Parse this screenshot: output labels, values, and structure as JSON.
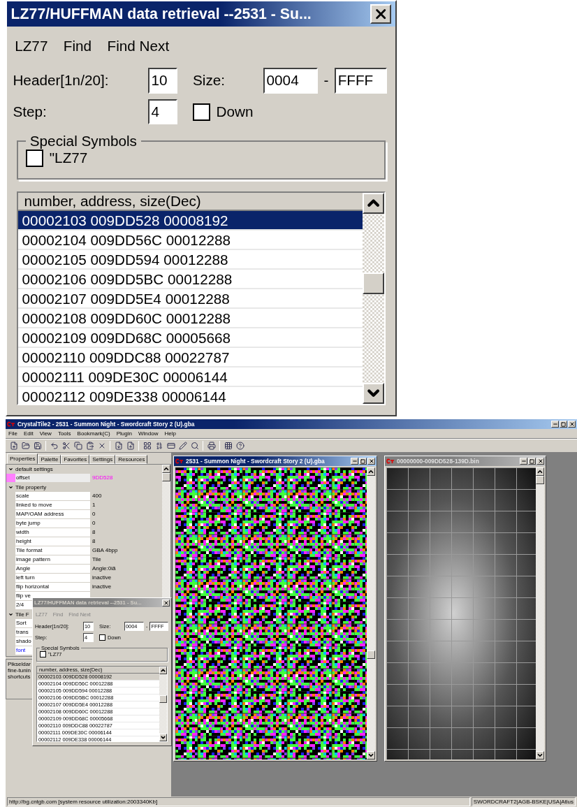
{
  "zoomed_dialog": {
    "title": "LZ77/HUFFMAN data retrieval --2531 - Su...",
    "active": true,
    "menu": [
      "LZ77",
      "Find",
      "Find Next"
    ],
    "header_label": "Header[1n/20]:",
    "header_value": "10",
    "size_label": "Size:",
    "size_from": "0004",
    "size_separator": "-",
    "size_to": "FFFF",
    "step_label": "Step:",
    "step_value": "4",
    "down": {
      "label": "Down",
      "checked": false
    },
    "group_title": "Special Symbols",
    "lz77": {
      "label": "\"LZ77",
      "checked": false
    },
    "list_header": "number, address, size(Dec)",
    "rows": [
      {
        "text": "00002103 009DD528 00008192",
        "selected": true
      },
      {
        "text": "00002104 009DD56C 00012288",
        "selected": false
      },
      {
        "text": "00002105 009DD594 00012288",
        "selected": false
      },
      {
        "text": "00002106 009DD5BC 00012288",
        "selected": false
      },
      {
        "text": "00002107 009DD5E4 00012288",
        "selected": false
      },
      {
        "text": "00002108 009DD60C 00012288",
        "selected": false
      },
      {
        "text": "00002109 009DD68C 00005668",
        "selected": false
      },
      {
        "text": "00002110 009DDC88 00022787",
        "selected": false
      },
      {
        "text": "00002111 009DE30C 00006144",
        "selected": false
      },
      {
        "text": "00002112 009DE338 00006144",
        "selected": false
      }
    ]
  },
  "app": {
    "title": "CrystalTile2 - 2531 - Summon Night - Swordcraft Story 2 (U).gba",
    "menu": [
      "File",
      "Edit",
      "View",
      "Tools",
      "Bookmark(C)",
      "Plugin",
      "Window",
      "Help"
    ],
    "panel_tabs": [
      {
        "label": "Properties",
        "selected": true
      },
      {
        "label": "Palette",
        "selected": false
      },
      {
        "label": "Favorites",
        "selected": false
      },
      {
        "label": "Settings",
        "selected": false
      },
      {
        "label": "Resources",
        "selected": false
      }
    ],
    "property_grid": [
      {
        "kind": "category",
        "label": "default settings",
        "expanded": true,
        "selected": false
      },
      {
        "kind": "property",
        "label": "offset",
        "value": "9DD528",
        "selected": true
      },
      {
        "kind": "category",
        "label": "Tile property",
        "expanded": true,
        "selected": false
      },
      {
        "kind": "property",
        "label": "scale",
        "value": "400",
        "selected": false
      },
      {
        "kind": "property",
        "label": "linked to move",
        "value": "1",
        "selected": false
      },
      {
        "kind": "property",
        "label": "MAP/OAM address",
        "value": "0",
        "selected": false
      },
      {
        "kind": "property",
        "label": "byte jump",
        "value": "0",
        "selected": false
      },
      {
        "kind": "property",
        "label": "width",
        "value": "8",
        "selected": false
      },
      {
        "kind": "property",
        "label": "height",
        "value": "8",
        "selected": false
      },
      {
        "kind": "property",
        "label": "Tile format",
        "value": "GBA 4bpp",
        "selected": false
      },
      {
        "kind": "property",
        "label": "image pattern",
        "value": "Tile",
        "selected": false
      },
      {
        "kind": "property",
        "label": "Angle",
        "value": "Angle:0iã",
        "selected": false
      },
      {
        "kind": "property",
        "label": "left turn",
        "value": "inactive",
        "selected": false
      },
      {
        "kind": "property",
        "label": "flip horizontal",
        "value": "inactive",
        "selected": false
      },
      {
        "kind": "property",
        "label": "flip ve",
        "selected": false
      },
      {
        "kind": "property",
        "label": "2/4",
        "selected": false
      },
      {
        "kind": "category",
        "label": "Tile F",
        "expanded": true,
        "selected": false
      },
      {
        "kind": "property",
        "label": "Sort",
        "selected": false
      },
      {
        "kind": "property",
        "label": "trans",
        "selected": false
      },
      {
        "kind": "property",
        "label": "shado",
        "selected": false
      },
      {
        "kind": "link",
        "label": "font",
        "selected": false
      }
    ],
    "description": [
      "Pikseldar",
      "fine-tunin",
      "shortcuts"
    ],
    "dialog": {
      "title": "LZ77/HUFFMAN data retrieval --2531 - Su...",
      "active": false,
      "menu": [
        "LZ77",
        "Find",
        "Find Next"
      ],
      "header_label": "Header[1n/20]:",
      "header_value": "10",
      "size_label": "Size:",
      "size_from": "0004",
      "size_separator": "-",
      "size_to": "FFFF",
      "step_label": "Step:",
      "step_value": "4",
      "down": {
        "label": "Down",
        "checked": false
      },
      "group_title": "Special Symbols",
      "lz77": {
        "label": "\"LZ77",
        "checked": false
      },
      "list_header": "number, address, size(Dec)",
      "rows": [
        {
          "text": "00002103 009DD528 00008192",
          "selected": true
        },
        {
          "text": "00002104 009DD56C 00012288",
          "selected": false
        },
        {
          "text": "00002105 009DD594 00012288",
          "selected": false
        },
        {
          "text": "00002106 009DD5BC 00012288",
          "selected": false
        },
        {
          "text": "00002107 009DD5E4 00012288",
          "selected": false
        },
        {
          "text": "00002108 009DD60C 00012288",
          "selected": false
        },
        {
          "text": "00002109 009DD68C 00005668",
          "selected": false
        },
        {
          "text": "00002110 009DDC88 00022787",
          "selected": false
        },
        {
          "text": "00002111 009DE30C 00006144",
          "selected": false
        },
        {
          "text": "00002112 009DE338 00006144",
          "selected": false
        }
      ]
    },
    "child_windows": [
      {
        "title": "2531 - Summon Night - Swordcraft Story 2 (U).gba",
        "active": true,
        "kind": "tiles"
      },
      {
        "title": "00000000-009DD528-139D.bin",
        "active": false,
        "kind": "image"
      }
    ],
    "status_bar": {
      "left": "http://bg.cntgb.com [system resource utilization:2003340Kb]",
      "right": "SWORDCRAFT2|AGB-BSKE|USA|Atlus"
    }
  }
}
